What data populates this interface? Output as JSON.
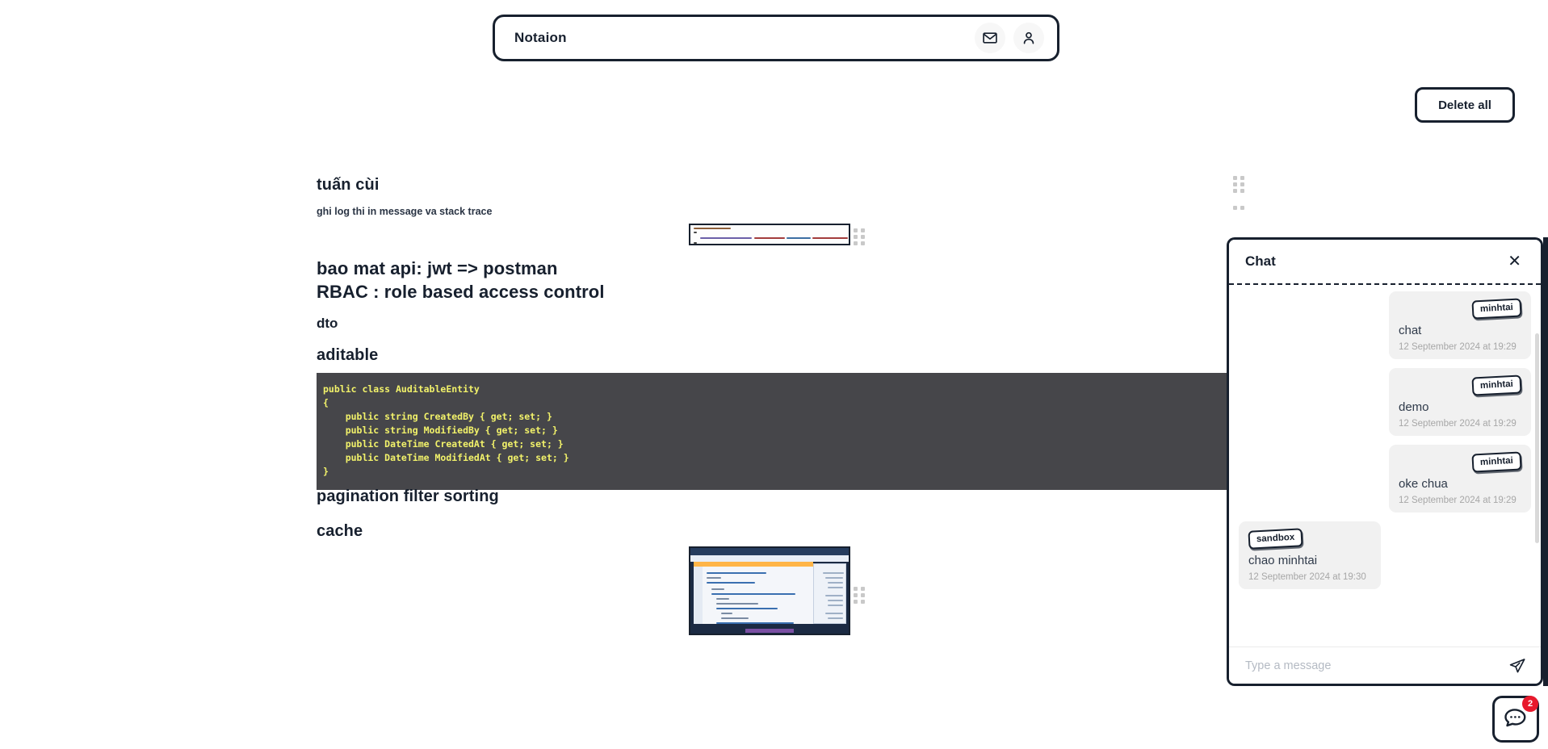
{
  "header": {
    "brand": "Notaion",
    "icons": [
      {
        "name": "mail-icon",
        "label": "Messages"
      },
      {
        "name": "user-icon",
        "label": "Account"
      }
    ]
  },
  "toolbar": {
    "delete_all_label": "Delete all"
  },
  "document": {
    "blocks": [
      {
        "type": "heading",
        "text": "tuấn cùi"
      },
      {
        "type": "paragraph",
        "text": "ghi log thi in message va stack trace"
      },
      {
        "type": "image",
        "alt": "logger code snippet screenshot"
      },
      {
        "type": "heading",
        "text": "bao mat api: jwt => postman"
      },
      {
        "type": "heading",
        "text": "RBAC : role based access control"
      },
      {
        "type": "heading",
        "text": "dto"
      },
      {
        "type": "heading",
        "text": "aditable"
      },
      {
        "type": "code",
        "language": "csharp"
      },
      {
        "type": "heading",
        "text": "pagination filter sorting"
      },
      {
        "type": "heading",
        "text": "cache"
      },
      {
        "type": "image",
        "alt": "visual studio IDE screenshot"
      }
    ],
    "headings": {
      "tuan_cui": "tuấn cùi",
      "log_note": "ghi log thi in message va stack trace",
      "bao_mat": "bao mat api: jwt => postman",
      "rbac": "RBAC : role based access control",
      "dto": "dto",
      "aditable": "aditable",
      "pagination": "pagination filter sorting",
      "cache": "cache"
    },
    "code_block": {
      "language": "csharp",
      "text": "public class AuditableEntity\n{\n    public string CreatedBy { get; set; }\n    public string ModifiedBy { get; set; }\n    public DateTime CreatedAt { get; set; }\n    public DateTime ModifiedAt { get; set; }\n}",
      "background": "#46464a",
      "foreground": "#f2f26a"
    }
  },
  "chat": {
    "title": "Chat",
    "close_label": "✕",
    "messages": [
      {
        "author": "minhtai",
        "text": "chat",
        "time": "12 September 2024 at 19:29",
        "side": "right"
      },
      {
        "author": "minhtai",
        "text": "demo",
        "time": "12 September 2024 at 19:29",
        "side": "right"
      },
      {
        "author": "minhtai",
        "text": "oke chua",
        "time": "12 September 2024 at 19:29",
        "side": "right"
      },
      {
        "author": "sandbox",
        "text": "chao minhtai",
        "time": "12 September 2024 at 19:30",
        "side": "left"
      }
    ],
    "input": {
      "value": "",
      "placeholder": "Type a message"
    },
    "send_icon": "send-icon"
  },
  "chat_fab": {
    "icon": "chat-bubble-icon",
    "unread_count": "2"
  },
  "colors": {
    "ink": "#17202e",
    "badge_red": "#e8192c",
    "code_bg": "#46464a",
    "code_fg": "#f2f26a",
    "bubble_bg": "#f1f1f1",
    "muted": "#a7a7a7"
  }
}
